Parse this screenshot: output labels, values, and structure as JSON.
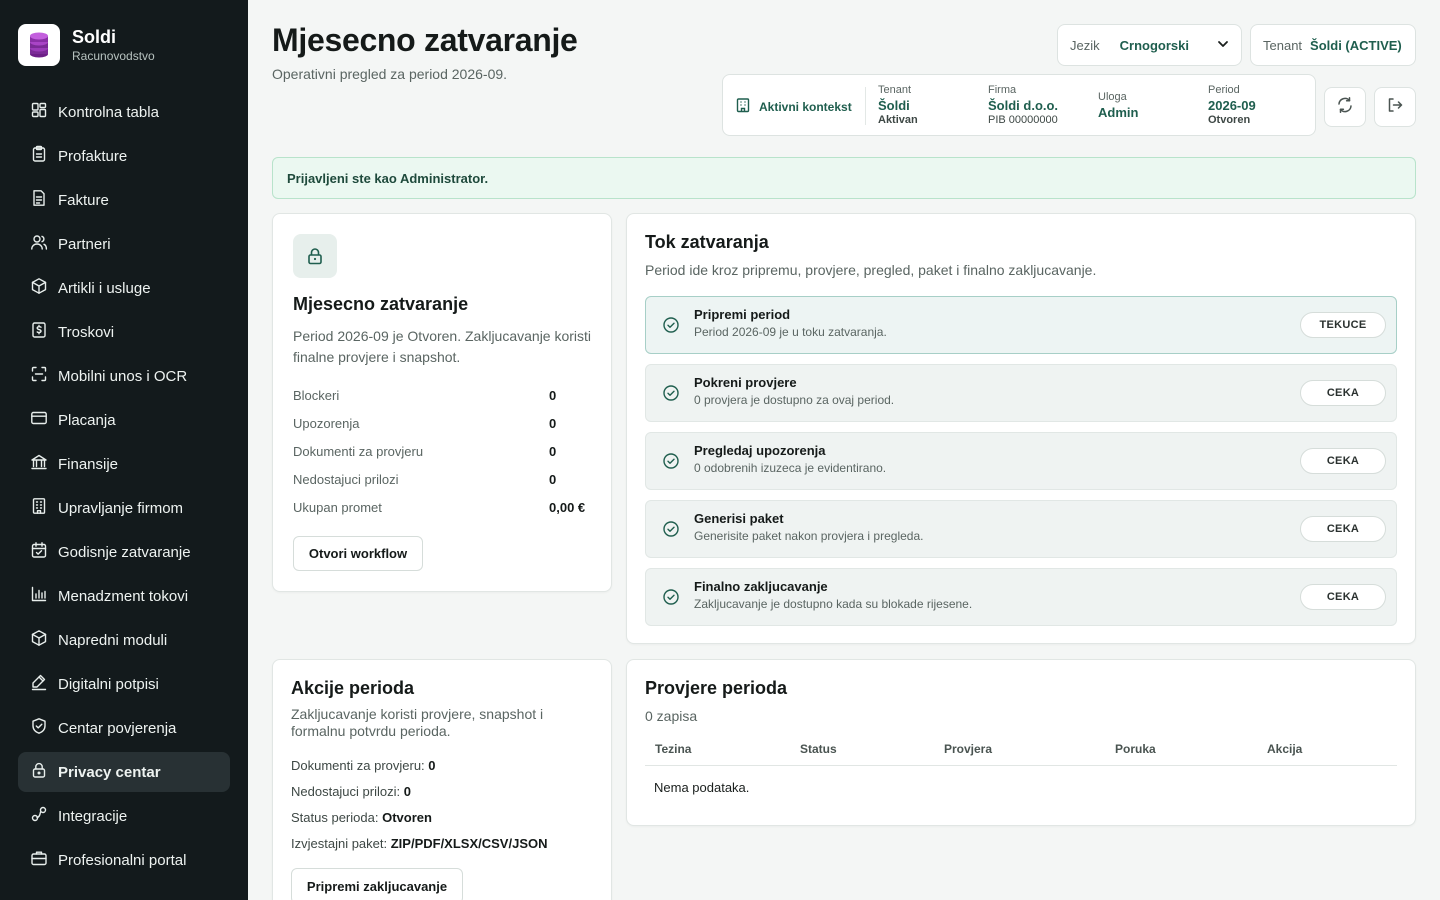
{
  "brand": {
    "name": "Soldi",
    "subtitle": "Racunovodstvo"
  },
  "sidebar": {
    "items": [
      {
        "label": "Kontrolna tabla",
        "icon": "dashboard-icon"
      },
      {
        "label": "Profakture",
        "icon": "clipboard-icon"
      },
      {
        "label": "Fakture",
        "icon": "document-icon"
      },
      {
        "label": "Partneri",
        "icon": "users-icon"
      },
      {
        "label": "Artikli i usluge",
        "icon": "box-icon"
      },
      {
        "label": "Troskovi",
        "icon": "receipt-icon"
      },
      {
        "label": "Mobilni unos i OCR",
        "icon": "scan-icon"
      },
      {
        "label": "Placanja",
        "icon": "card-icon"
      },
      {
        "label": "Finansije",
        "icon": "bank-icon"
      },
      {
        "label": "Upravljanje firmom",
        "icon": "building-icon"
      },
      {
        "label": "Godisnje zatvaranje",
        "icon": "calendar-icon"
      },
      {
        "label": "Menadzment tokovi",
        "icon": "bar-chart-icon"
      },
      {
        "label": "Napredni moduli",
        "icon": "box-icon"
      },
      {
        "label": "Digitalni potpisi",
        "icon": "signature-icon"
      },
      {
        "label": "Centar povjerenja",
        "icon": "shield-icon"
      },
      {
        "label": "Privacy centar",
        "icon": "lock-icon",
        "active": true
      },
      {
        "label": "Integracije",
        "icon": "link-icon"
      },
      {
        "label": "Profesionalni portal",
        "icon": "briefcase-icon"
      }
    ]
  },
  "header": {
    "title": "Mjesecno zatvaranje",
    "subtitle": "Operativni pregled za period 2026-09.",
    "language_label": "Jezik",
    "language_value": "Crnogorski",
    "tenant_label": "Tenant",
    "tenant_value": "Šoldi (ACTIVE)"
  },
  "context": {
    "heading": "Aktivni kontekst",
    "tenant": {
      "label": "Tenant",
      "value": "Šoldi",
      "sub": "Aktivan"
    },
    "firma": {
      "label": "Firma",
      "value": "Šoldi d.o.o.",
      "sub": "PIB 00000000"
    },
    "uloga": {
      "label": "Uloga",
      "value": "Admin"
    },
    "period": {
      "label": "Period",
      "value": "2026-09",
      "sub": "Otvoren"
    }
  },
  "alert": "Prijavljeni ste kao Administrator.",
  "summary": {
    "title": "Mjesecno zatvaranje",
    "description": "Period 2026-09 je Otvoren. Zakljucavanje koristi finalne provjere i snapshot.",
    "stats": [
      {
        "label": "Blockeri",
        "value": "0"
      },
      {
        "label": "Upozorenja",
        "value": "0"
      },
      {
        "label": "Dokumenti za provjeru",
        "value": "0"
      },
      {
        "label": "Nedostajuci prilozi",
        "value": "0"
      },
      {
        "label": "Ukupan promet",
        "value": "0,00 €"
      }
    ],
    "button": "Otvori workflow"
  },
  "flow": {
    "title": "Tok zatvaranja",
    "description": "Period ide kroz pripremu, provjere, pregled, paket i finalno zakljucavanje.",
    "steps": [
      {
        "title": "Pripremi period",
        "desc": "Period 2026-09 je u toku zatvaranja.",
        "status": "TEKUCE"
      },
      {
        "title": "Pokreni provjere",
        "desc": "0 provjera je dostupno za ovaj period.",
        "status": "CEKA"
      },
      {
        "title": "Pregledaj upozorenja",
        "desc": "0 odobrenih izuzeca je evidentirano.",
        "status": "CEKA"
      },
      {
        "title": "Generisi paket",
        "desc": "Generisite paket nakon provjera i pregleda.",
        "status": "CEKA"
      },
      {
        "title": "Finalno zakljucavanje",
        "desc": "Zakljucavanje je dostupno kada su blokade rijesene.",
        "status": "CEKA"
      }
    ]
  },
  "actions": {
    "title": "Akcije perioda",
    "description": "Zakljucavanje koristi provjere, snapshot i formalnu potvrdu perioda.",
    "items": [
      {
        "label": "Dokumenti za provjeru:",
        "value": "0"
      },
      {
        "label": "Nedostajuci prilozi:",
        "value": "0"
      },
      {
        "label": "Status perioda:",
        "value": "Otvoren"
      },
      {
        "label": "Izvjestajni paket:",
        "value": "ZIP/PDF/XLSX/CSV/JSON"
      }
    ],
    "button": "Pripremi zakljucavanje"
  },
  "checks": {
    "title": "Provjere perioda",
    "count": "0 zapisa",
    "columns": [
      "Tezina",
      "Status",
      "Provjera",
      "Poruka",
      "Akcija"
    ],
    "empty": "Nema podataka."
  },
  "colors": {
    "accent": "#1f5e4e",
    "sidebar": "#131a1c",
    "alert_bg": "#ebf8f1"
  }
}
